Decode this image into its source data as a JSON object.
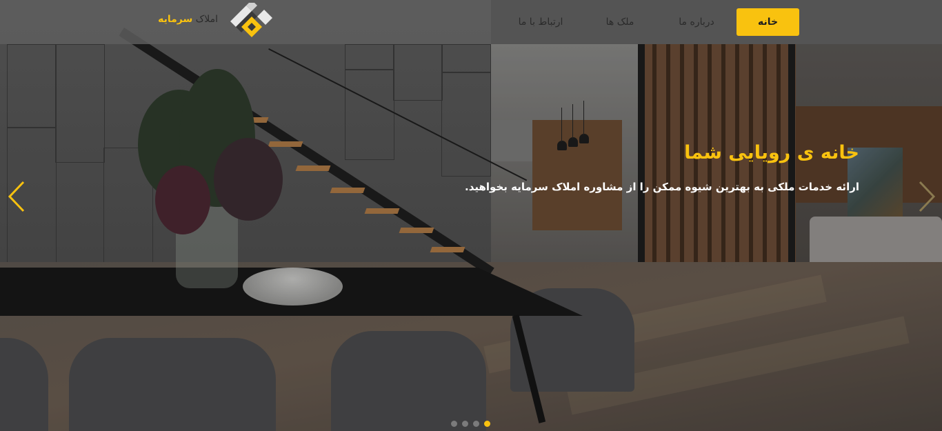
{
  "nav": {
    "items": [
      {
        "label": "خانه",
        "active": true
      },
      {
        "label": "درباره ما",
        "active": false
      },
      {
        "label": "ملک ها",
        "active": false
      },
      {
        "label": "ارتباط با ما",
        "active": false
      }
    ]
  },
  "brand": {
    "prefix": "املاک",
    "name": "سرمایه",
    "logo_icon": "house-blocks-logo-icon"
  },
  "hero": {
    "title": "خانه ی رویایی شما",
    "subtitle": "ارائه خدمات ملکی به بهترین شیوه ممکن را از مشاوره املاک سرمایه بخواهید."
  },
  "carousel": {
    "prev_icon": "chevron-left-icon",
    "next_icon": "chevron-right-icon",
    "slide_count": 4,
    "active_slide": 4
  },
  "colors": {
    "accent": "#f9c20f",
    "navbar": "#5f5f5f",
    "text_light": "#ffffff"
  }
}
